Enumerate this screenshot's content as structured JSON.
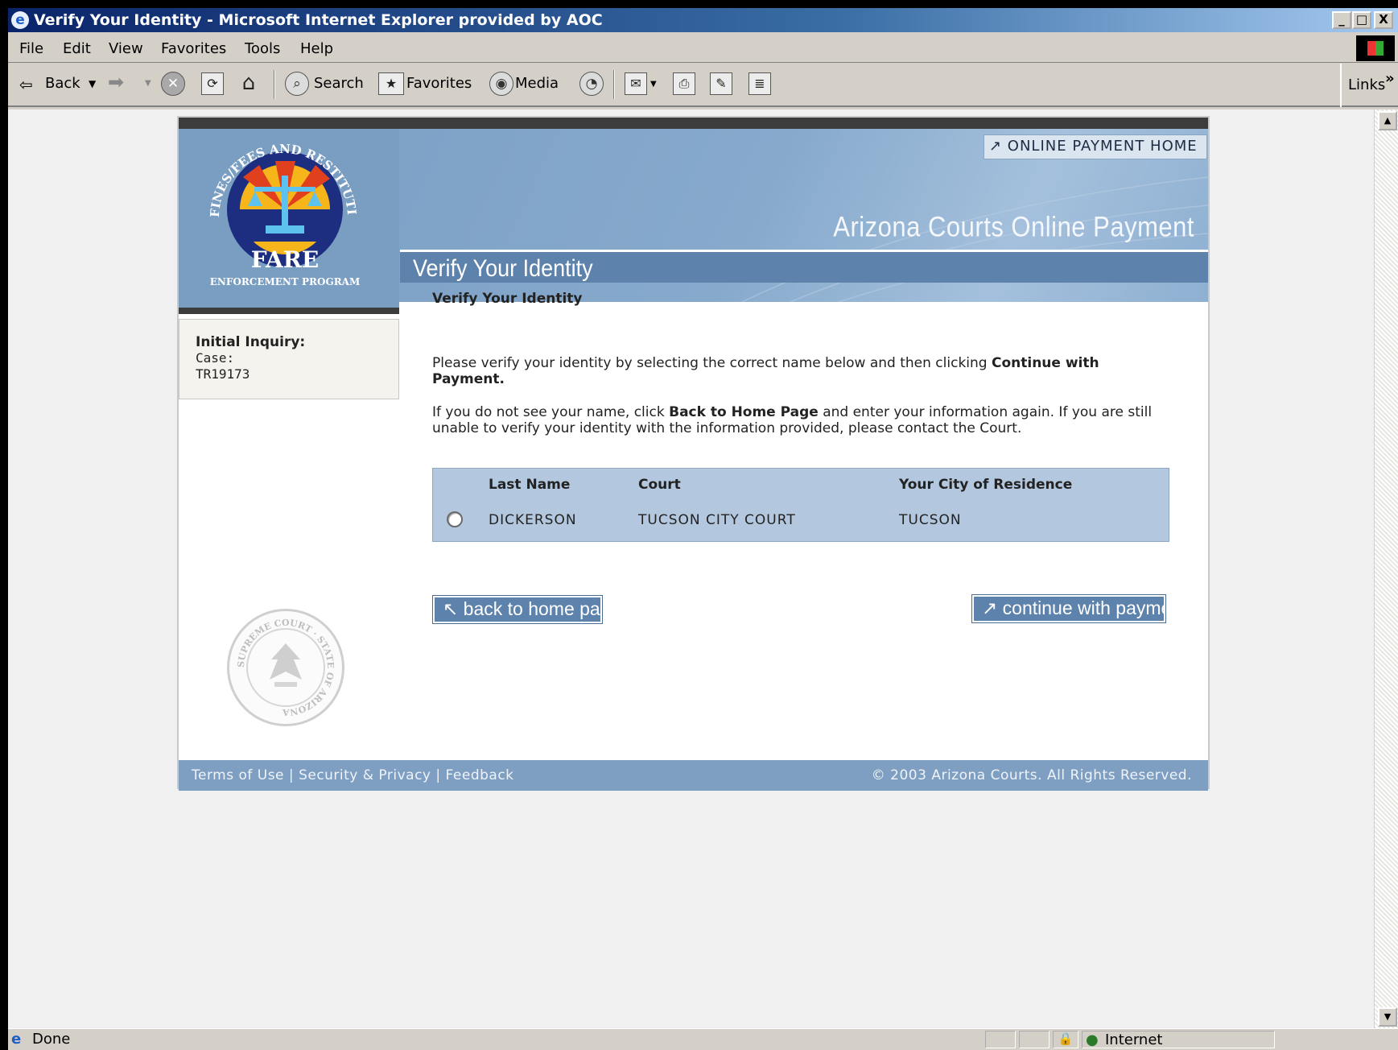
{
  "window": {
    "title": "Verify Your Identity - Microsoft Internet Explorer provided by AOC",
    "minimize": "_",
    "restore": "□",
    "close": "X"
  },
  "menubar": [
    "File",
    "Edit",
    "View",
    "Favorites",
    "Tools",
    "Help"
  ],
  "toolbar": {
    "back": "Back",
    "search": "Search",
    "favorites": "Favorites",
    "media": "Media",
    "links": "Links",
    "chevron": "»"
  },
  "status": {
    "text": "Done",
    "zone": "Internet"
  },
  "site": {
    "home_link": "↗ ONLINE PAYMENT HOME",
    "title": "Arizona Courts Online Payment",
    "page_heading": "Verify Your Identity",
    "logo": {
      "arc_text": "FINES/FEES AND RESTITUTION",
      "name": "FARE",
      "program": "ENFORCEMENT PROGRAM"
    },
    "seal_text": "SUPREME COURT · STATE OF ARIZONA"
  },
  "inquiry": {
    "title": "Initial Inquiry:",
    "case_label": "Case:",
    "case_number": "TR19173"
  },
  "content": {
    "subheading": "Verify Your Identity",
    "p1_pre": "Please verify your identity by selecting the correct name below and then clicking ",
    "p1_bold": "Continue with Payment.",
    "p2_pre": "If you do not see your name, click ",
    "p2_bold": "Back to Home Page",
    "p2_post": " and enter your information again. If you are still unable to verify your identity with the information provided, please contact the Court."
  },
  "table": {
    "headers": [
      "Last Name",
      "Court",
      "Your City of Residence"
    ],
    "rows": [
      {
        "last_name": "DICKERSON",
        "court": "TUCSON CITY COURT",
        "city": "TUCSON",
        "selected": false
      }
    ]
  },
  "buttons": {
    "back_home": "↖ back to home page",
    "continue": "↗ continue with payment"
  },
  "footer": {
    "links": [
      "Terms of Use",
      "Security & Privacy",
      "Feedback"
    ],
    "separator": " | ",
    "copyright": "© 2003 Arizona Courts. All Rights Reserved."
  }
}
